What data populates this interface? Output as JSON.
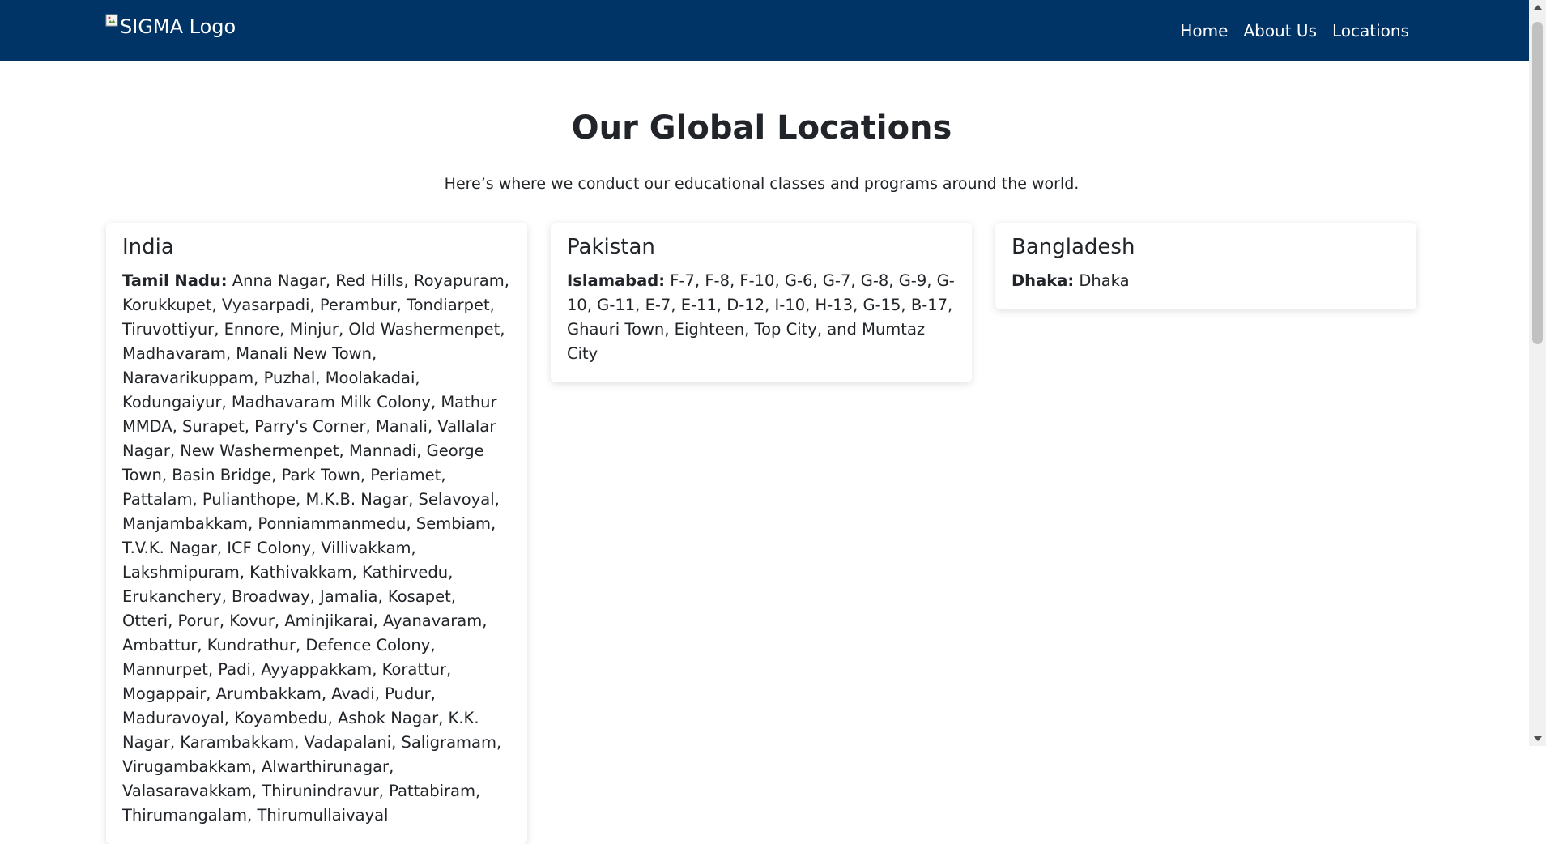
{
  "header": {
    "logo_alt": "SIGMA Logo",
    "nav": [
      {
        "label": "Home"
      },
      {
        "label": "About Us"
      },
      {
        "label": "Locations"
      }
    ]
  },
  "main": {
    "title": "Our Global Locations",
    "subtitle": "Here’s where we conduct our educational classes and programs around the world.",
    "cards": [
      {
        "country": "India",
        "region": "Tamil Nadu:",
        "places": "Anna Nagar, Red Hills, Royapuram, Korukkupet, Vyasarpadi, Perambur, Tondiarpet, Tiruvottiyur, Ennore, Minjur, Old Washermenpet, Madhavaram, Manali New Town, Naravarikuppam, Puzhal, Moolakadai, Kodungaiyur, Madhavaram Milk Colony, Mathur MMDA, Surapet, Parry's Corner, Manali, Vallalar Nagar, New Washermenpet, Mannadi, George Town, Basin Bridge, Park Town, Periamet, Pattalam, Pulianthope, M.K.B. Nagar, Selavoyal, Manjambakkam, Ponniammanmedu, Sembiam, T.V.K. Nagar, ICF Colony, Villivakkam, Lakshmipuram, Kathivakkam, Kathirvedu, Erukanchery, Broadway, Jamalia, Kosapet, Otteri, Porur, Kovur, Aminjikarai, Ayanavaram, Ambattur, Kundrathur, Defence Colony, Mannurpet, Padi, Ayyappakkam, Korattur, Mogappair, Arumbakkam, Avadi, Pudur, Maduravoyal, Koyambedu, Ashok Nagar, K.K. Nagar, Karambakkam, Vadapalani, Saligramam, Virugambakkam, Alwarthirunagar, Valasaravakkam, Thirunindravur, Pattabiram, Thirumangalam, Thirumullaivayal"
      },
      {
        "country": "Pakistan",
        "region": "Islamabad:",
        "places": "F-7, F-8, F-10, G-6, G-7, G-8, G-9, G-10, G-11, E-7, E-11, D-12, I-10, H-13, G-15, B-17, Ghauri Town, Eighteen, Top City, and Mumtaz City"
      },
      {
        "country": "Bangladesh",
        "region": "Dhaka:",
        "places": "Dhaka"
      }
    ]
  },
  "colors": {
    "navbar": "#003366",
    "text": "#212529",
    "card_bg": "#ffffff"
  }
}
